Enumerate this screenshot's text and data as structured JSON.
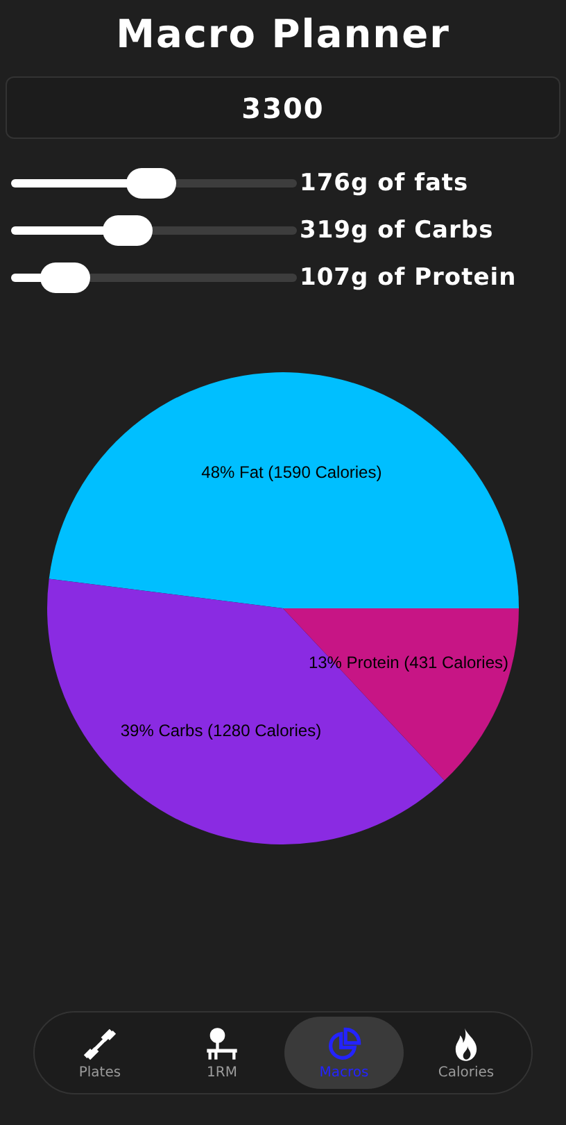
{
  "title": "Macro Planner",
  "calories_field": {
    "value": "3300"
  },
  "sliders": [
    {
      "level": 0.49,
      "reading": "176g of fats"
    },
    {
      "level": 0.41,
      "reading": "319g of Carbs"
    },
    {
      "level": 0.19,
      "reading": "107g of Protein"
    }
  ],
  "chart_data": {
    "type": "pie",
    "values": [
      48,
      39,
      13
    ],
    "colors": [
      "#00bfff",
      "#8a2be2",
      "#c71585"
    ],
    "value_labels": [
      "48% Fat (1590 Calories)",
      "39% Carbs (1280 Calories)",
      "13% Protein (431 Calories)"
    ]
  },
  "tabs": [
    {
      "kind": "plates",
      "label": "Plates",
      "selected": false
    },
    {
      "kind": "onerm",
      "label": "1RM",
      "selected": false
    },
    {
      "kind": "macros",
      "label": "Macros",
      "selected": true
    },
    {
      "kind": "calories",
      "label": "Calories",
      "selected": false
    }
  ]
}
